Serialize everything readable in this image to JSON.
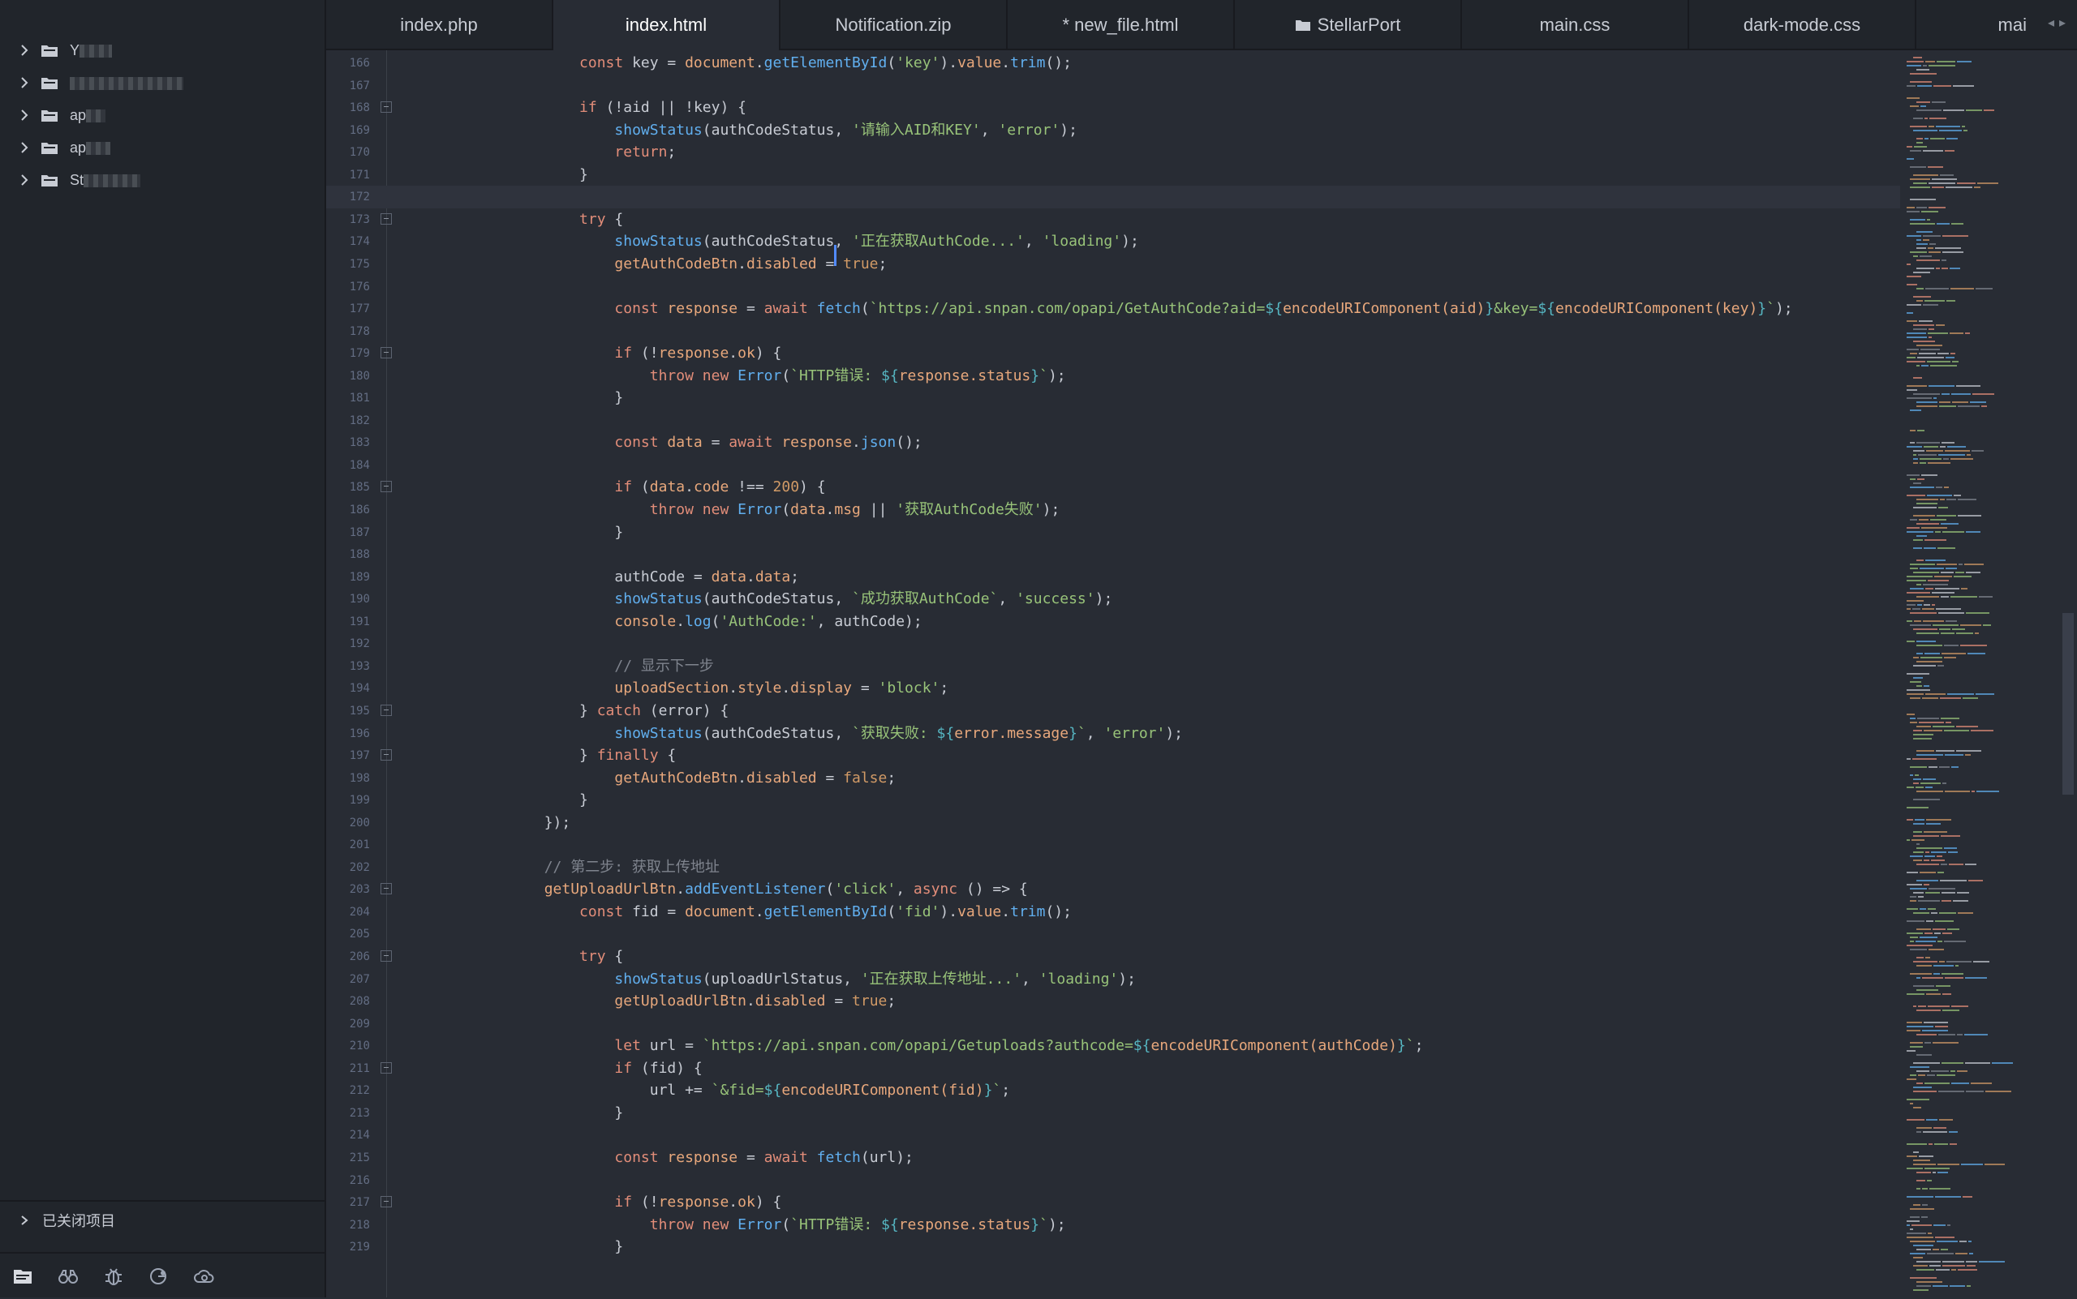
{
  "sidebar": {
    "items": [
      {
        "label": "Y",
        "redacted": "redacted"
      },
      {
        "label": "",
        "redacted": "redacted"
      },
      {
        "label": "ap",
        "redacted": "redacted"
      },
      {
        "label": "ap",
        "redacted": "redacted"
      },
      {
        "label": "St",
        "redacted": "redacted"
      }
    ],
    "closed_projects_label": "已关闭项目",
    "toolbar": [
      "files-icon",
      "binoculars-icon",
      "bug-icon",
      "git-icon",
      "cloud-icon"
    ]
  },
  "tabs": [
    {
      "label": "index.php"
    },
    {
      "label": "index.html"
    },
    {
      "label": "Notification.zip"
    },
    {
      "label": "* new_file.html"
    },
    {
      "label": "StellarPort"
    },
    {
      "label": "main.css"
    },
    {
      "label": "dark-mode.css"
    },
    {
      "label": "mai"
    }
  ],
  "colors": {
    "background": "#282c34",
    "sidebar": "#21252b",
    "keyword": "#e28d79",
    "function": "#61afef",
    "string": "#98c379",
    "comment": "#7f848e"
  },
  "editor": {
    "lines": [
      {
        "n": "166",
        "fold": false,
        "code": "            const key = document.getElementById('key').value.trim();"
      },
      {
        "n": "167",
        "fold": false,
        "code": ""
      },
      {
        "n": "168",
        "fold": true,
        "code": "            if (!aid || !key) {"
      },
      {
        "n": "169",
        "fold": false,
        "code": "                showStatus(authCodeStatus, '请输入AID和KEY', 'error');"
      },
      {
        "n": "170",
        "fold": false,
        "code": "                return;"
      },
      {
        "n": "171",
        "fold": false,
        "code": "            }"
      },
      {
        "n": "172",
        "fold": false,
        "code": ""
      },
      {
        "n": "173",
        "fold": true,
        "code": "            try {"
      },
      {
        "n": "174",
        "fold": false,
        "code": "                showStatus(authCodeStatus, '正在获取AuthCode...', 'loading');"
      },
      {
        "n": "175",
        "fold": false,
        "code": "                getAuthCodeBtn.disabled = true;"
      },
      {
        "n": "176",
        "fold": false,
        "code": ""
      },
      {
        "n": "177",
        "fold": false,
        "code": "                const response = await fetch(`https://api.snpan.com/opapi/GetAuthCode?aid=${encodeURIComponent(aid)}&key=${encodeURIComponent(key)}`);"
      },
      {
        "n": "178",
        "fold": false,
        "code": ""
      },
      {
        "n": "179",
        "fold": true,
        "code": "                if (!response.ok) {"
      },
      {
        "n": "180",
        "fold": false,
        "code": "                    throw new Error(`HTTP错误: ${response.status}`);"
      },
      {
        "n": "181",
        "fold": false,
        "code": "                }"
      },
      {
        "n": "182",
        "fold": false,
        "code": ""
      },
      {
        "n": "183",
        "fold": false,
        "code": "                const data = await response.json();"
      },
      {
        "n": "184",
        "fold": false,
        "code": ""
      },
      {
        "n": "185",
        "fold": true,
        "code": "                if (data.code !== 200) {"
      },
      {
        "n": "186",
        "fold": false,
        "code": "                    throw new Error(data.msg || '获取AuthCode失败');"
      },
      {
        "n": "187",
        "fold": false,
        "code": "                }"
      },
      {
        "n": "188",
        "fold": false,
        "code": ""
      },
      {
        "n": "189",
        "fold": false,
        "code": "                authCode = data.data;"
      },
      {
        "n": "190",
        "fold": false,
        "code": "                showStatus(authCodeStatus, `成功获取AuthCode`, 'success');"
      },
      {
        "n": "191",
        "fold": false,
        "code": "                console.log('AuthCode:', authCode);"
      },
      {
        "n": "192",
        "fold": false,
        "code": ""
      },
      {
        "n": "193",
        "fold": false,
        "code": "                // 显示下一步"
      },
      {
        "n": "194",
        "fold": false,
        "code": "                uploadSection.style.display = 'block';"
      },
      {
        "n": "195",
        "fold": true,
        "code": "            } catch (error) {"
      },
      {
        "n": "196",
        "fold": false,
        "code": "                showStatus(authCodeStatus, `获取失败: ${error.message}`, 'error');"
      },
      {
        "n": "197",
        "fold": true,
        "code": "            } finally {"
      },
      {
        "n": "198",
        "fold": false,
        "code": "                getAuthCodeBtn.disabled = false;"
      },
      {
        "n": "199",
        "fold": false,
        "code": "            }"
      },
      {
        "n": "200",
        "fold": false,
        "code": "        });"
      },
      {
        "n": "201",
        "fold": false,
        "code": ""
      },
      {
        "n": "202",
        "fold": false,
        "code": "        // 第二步: 获取上传地址"
      },
      {
        "n": "203",
        "fold": true,
        "code": "        getUploadUrlBtn.addEventListener('click', async () => {"
      },
      {
        "n": "204",
        "fold": false,
        "code": "            const fid = document.getElementById('fid').value.trim();"
      },
      {
        "n": "205",
        "fold": false,
        "code": ""
      },
      {
        "n": "206",
        "fold": true,
        "code": "            try {"
      },
      {
        "n": "207",
        "fold": false,
        "code": "                showStatus(uploadUrlStatus, '正在获取上传地址...', 'loading');"
      },
      {
        "n": "208",
        "fold": false,
        "code": "                getUploadUrlBtn.disabled = true;"
      },
      {
        "n": "209",
        "fold": false,
        "code": ""
      },
      {
        "n": "210",
        "fold": false,
        "code": "                let url = `https://api.snpan.com/opapi/Getuploads?authcode=${encodeURIComponent(authCode)}`;"
      },
      {
        "n": "211",
        "fold": true,
        "code": "                if (fid) {"
      },
      {
        "n": "212",
        "fold": false,
        "code": "                    url += `&fid=${encodeURIComponent(fid)}`;"
      },
      {
        "n": "213",
        "fold": false,
        "code": "                }"
      },
      {
        "n": "214",
        "fold": false,
        "code": ""
      },
      {
        "n": "215",
        "fold": false,
        "code": "                const response = await fetch(url);"
      },
      {
        "n": "216",
        "fold": false,
        "code": ""
      },
      {
        "n": "217",
        "fold": true,
        "code": "                if (!response.ok) {"
      },
      {
        "n": "218",
        "fold": false,
        "code": "                    throw new Error(`HTTP错误: ${response.status}`);"
      },
      {
        "n": "219",
        "fold": false,
        "code": "                }"
      }
    ],
    "current_line": "172"
  }
}
